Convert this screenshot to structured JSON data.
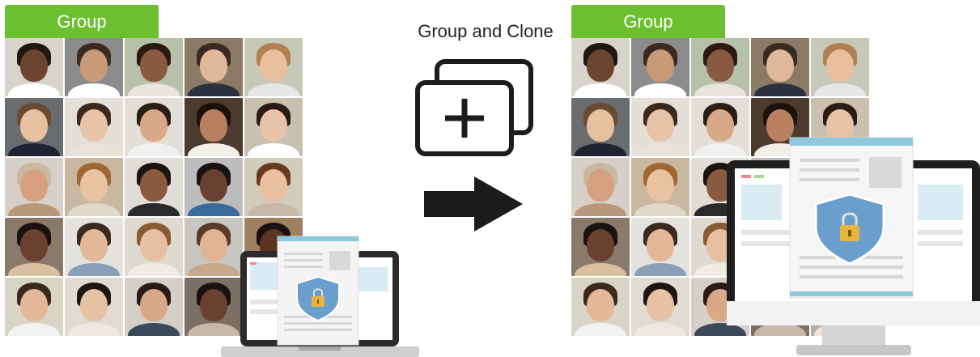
{
  "left_panel": {
    "group_label": "Group"
  },
  "right_panel": {
    "group_label": "Group"
  },
  "center": {
    "title": "Group and Clone"
  },
  "colors": {
    "group_tag": "#6cbf2e",
    "shield": "#6a9fcd",
    "lock": "#e7b43f",
    "doc_header": "#8fc8dc"
  },
  "icons": [
    "clone-icon",
    "arrow-right-icon",
    "laptop-icon",
    "desktop-monitor-icon",
    "shield-lock-icon"
  ]
}
